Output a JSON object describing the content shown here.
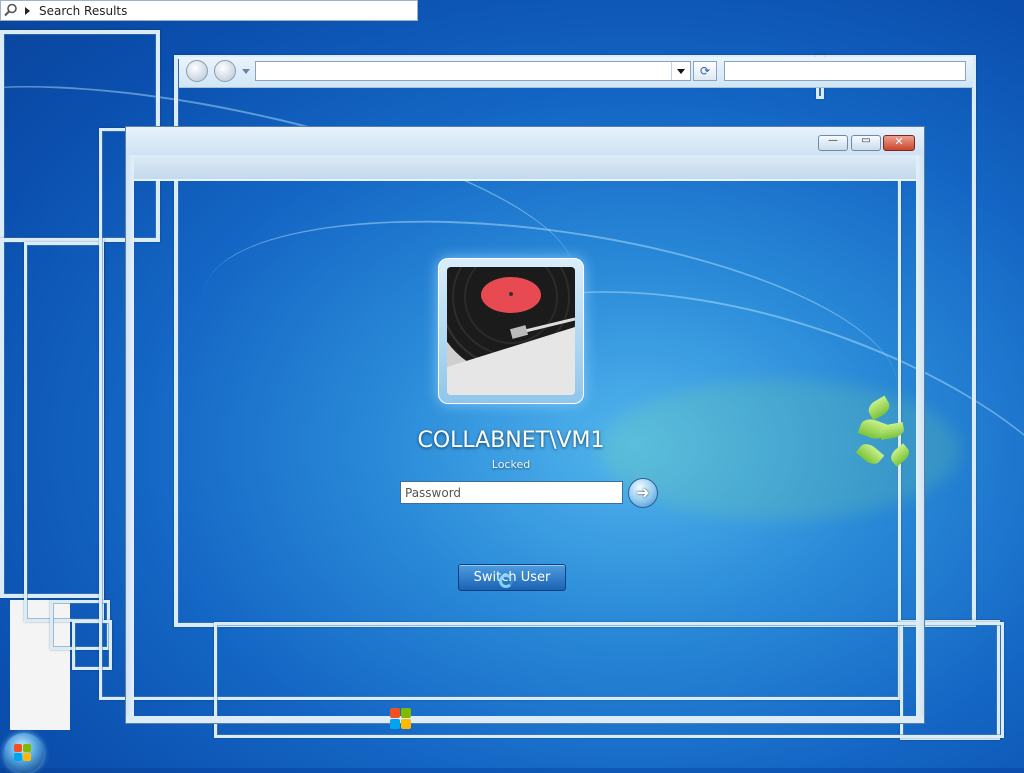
{
  "search_bar": {
    "text": "Search Results"
  },
  "logon": {
    "username": "COLLABNET\\VM1",
    "status": "Locked",
    "password_placeholder": "Password",
    "switch_user_label": "Switch User"
  },
  "window": {
    "minimize_glyph": "—",
    "maximize_glyph": "▭",
    "close_glyph": "✕",
    "refresh_glyph": "⟳"
  },
  "colors": {
    "wallpaper": "#1f7ad0",
    "frame": "#d9ecf8",
    "close_button": "#c8452c"
  },
  "icons": [
    "search-icon",
    "back-icon",
    "forward-icon",
    "refresh-icon",
    "arrow-right-icon",
    "windows-orb-icon"
  ]
}
